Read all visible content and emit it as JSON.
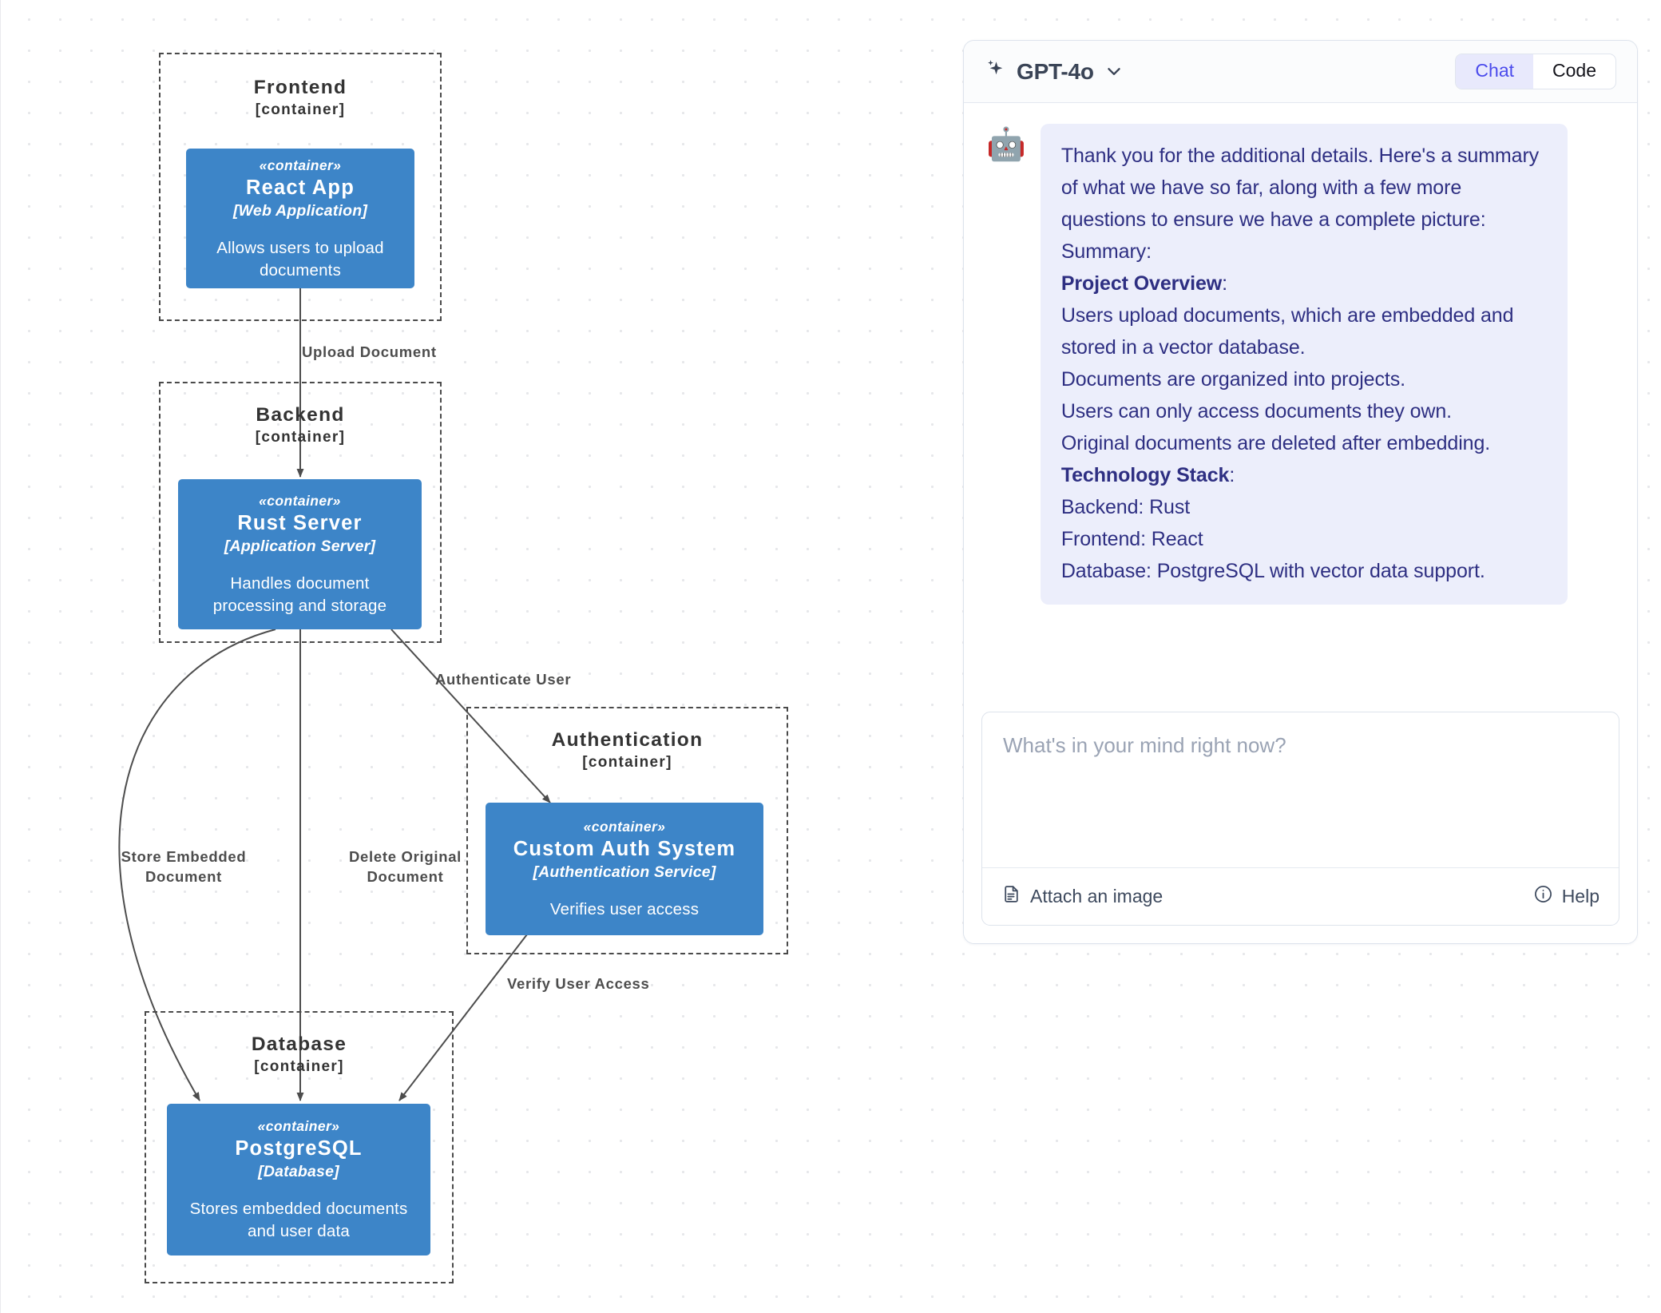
{
  "diagram": {
    "boundaries": [
      {
        "name": "Frontend",
        "type": "[container]"
      },
      {
        "name": "Backend",
        "type": "[container]"
      },
      {
        "name": "Authentication",
        "type": "[container]"
      },
      {
        "name": "Database",
        "type": "[container]"
      }
    ],
    "nodes": [
      {
        "stereotype": "«container»",
        "name": "React App",
        "technology": "[Web Application]",
        "description": "Allows users to upload documents"
      },
      {
        "stereotype": "«container»",
        "name": "Rust Server",
        "technology": "[Application Server]",
        "description": "Handles document processing and storage"
      },
      {
        "stereotype": "«container»",
        "name": "Custom Auth System",
        "technology": "[Authentication Service]",
        "description": "Verifies user access"
      },
      {
        "stereotype": "«container»",
        "name": "PostgreSQL",
        "technology": "[Database]",
        "description": "Stores embedded documents and user data"
      }
    ],
    "edge_labels": [
      "Upload Document",
      "Authenticate User",
      "Store Embedded\nDocument",
      "Delete Original\nDocument",
      "Verify User Access"
    ],
    "node_fill": "#3d85c8",
    "boundary_stroke": "#4a4a4a",
    "edge_stroke": "#4d4d4d"
  },
  "chat": {
    "model_label": "GPT-4o",
    "sparkle_icon": "sparkle-icon",
    "chevron_icon": "chevron-down-icon",
    "tabs": [
      {
        "label": "Chat",
        "active": true
      },
      {
        "label": "Code",
        "active": false
      }
    ],
    "avatar_emoji": "🤖",
    "message": {
      "p1": "Thank you for the additional details. Here's a summary of what we have so far, along with a few more questions to ensure we have a complete picture:",
      "p2": "Summary:",
      "h1": "Project Overview",
      "h1_suffix": ":",
      "p3": "Users upload documents, which are embedded and stored in a vector database.",
      "p4": "Documents are organized into projects.",
      "p5": "Users can only access documents they own.",
      "p6": "Original documents are deleted after embedding.",
      "h2": "Technology Stack",
      "h2_suffix": ":",
      "p7": "Backend: Rust",
      "p8": "Frontend: React",
      "p9": "Database: PostgreSQL with vector data support."
    },
    "composer": {
      "value": "",
      "placeholder": "What's in your mind right now?",
      "attach_label": "Attach an image",
      "help_label": "Help"
    },
    "accent_color": "#4b4bec",
    "bubble_bg": "#eceefb",
    "bubble_text": "#2e2f82"
  }
}
